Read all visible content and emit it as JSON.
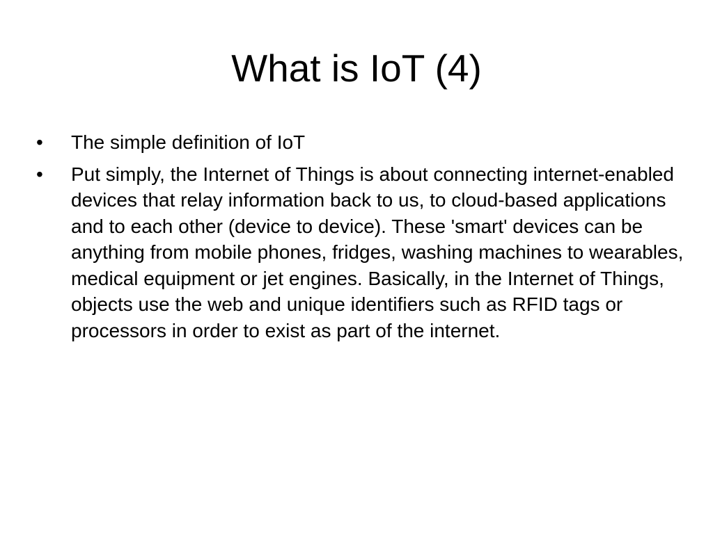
{
  "slide": {
    "title": "What is IoT (4)",
    "bullets": [
      {
        "marker": "•",
        "text": "The simple definition of IoT"
      },
      {
        "marker": "•",
        "text": "Put simply, the Internet of Things is about connecting internet-enabled devices that relay information back to us, to cloud-based applications and to each other (device to device). These 'smart' devices can be anything from mobile phones, fridges, washing machines to wearables, medical equipment or jet engines. Basically, in the Internet of Things, objects use the web and unique identifiers such as RFID tags or processors in order to exist as part of the internet."
      }
    ]
  }
}
